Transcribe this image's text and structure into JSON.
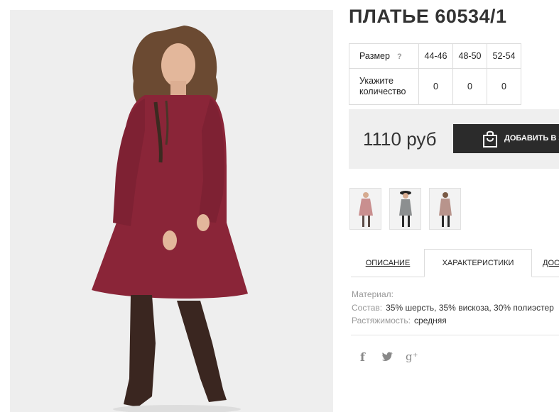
{
  "product": {
    "title": "ПЛАТЬЕ 60534/1"
  },
  "size_table": {
    "size_label": "Размер",
    "help_mark": "?",
    "sizes": [
      "44-46",
      "48-50",
      "52-54"
    ],
    "qty_label_line1": "Укажите",
    "qty_label_line2": "количество",
    "quantities": [
      "0",
      "0",
      "0"
    ]
  },
  "purchase": {
    "price": "1110 руб",
    "add_to_cart_label": "ДОБАВИТЬ В З"
  },
  "thumbnails": [
    {
      "name": "thumb-dress-pink",
      "color": "#c98f8f"
    },
    {
      "name": "thumb-dress-gray",
      "color": "#8c8f90"
    },
    {
      "name": "thumb-dress-beige",
      "color": "#b8948c"
    }
  ],
  "tabs": {
    "description": "ОПИСАНИЕ",
    "characteristics": "ХАРАКТЕРИСТИКИ",
    "delivery": "ДОС"
  },
  "characteristics": [
    {
      "key": "Материал:",
      "value": ""
    },
    {
      "key": "Состав:",
      "value": "35% шерсть, 35% вискоза, 30% полиэстер"
    },
    {
      "key": "Растяжимость:",
      "value": "средняя"
    }
  ],
  "social": {
    "facebook_glyph": "f",
    "googleplus_glyph": "g⁺"
  },
  "colors": {
    "dress": "#8a2538",
    "boots": "#3a2620",
    "button_bg": "#2b2b2b",
    "price_box_bg": "#efefef"
  }
}
